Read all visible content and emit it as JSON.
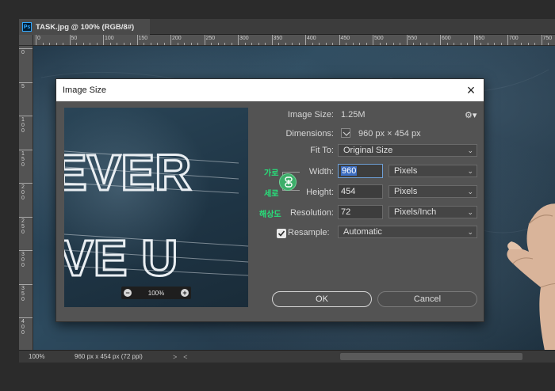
{
  "document": {
    "tab_label": "TASK.jpg @ 100% (RGB/8#)",
    "app_icon": "Ps"
  },
  "rulers": {
    "horizontal": [
      "0",
      "50",
      "100",
      "150",
      "200",
      "250",
      "300",
      "350",
      "400",
      "450",
      "500",
      "550",
      "600",
      "650",
      "700",
      "750"
    ],
    "vertical": [
      "0",
      "5",
      "1 0 0",
      "1 5 0",
      "2 0 0",
      "2 5 0",
      "3 0 0",
      "3 5 0",
      "4 0 0"
    ]
  },
  "status_bar": {
    "zoom": "100%",
    "info": "960 px x 454 px (72 ppi)",
    "arrow": ">",
    "arrow_left": "<"
  },
  "dialog": {
    "title": "Image Size",
    "close_icon": "×",
    "image_size_label": "Image Size:",
    "image_size_value": "1.25M",
    "gear_icon": "⚙▾",
    "dimensions_label": "Dimensions:",
    "dimensions_value": "960 px  ×  454 px",
    "fit_to_label": "Fit To:",
    "fit_to_value": "Original Size",
    "width_label": "Width:",
    "width_value": "960",
    "width_unit": "Pixels",
    "height_label": "Height:",
    "height_value": "454",
    "height_unit": "Pixels",
    "resolution_label": "Resolution:",
    "resolution_value": "72",
    "resolution_unit": "Pixels/Inch",
    "resample_label": "Resample:",
    "resample_value": "Automatic",
    "ok_label": "OK",
    "cancel_label": "Cancel",
    "preview_zoom": "100%",
    "preview_text_line1": "EVER",
    "preview_text_line2": "VE U",
    "annotations": {
      "width_korean": "가로",
      "height_korean": "세로",
      "resolution_korean": "해상도"
    }
  },
  "colors": {
    "accent_green": "#28e07a",
    "link_green": "#3dae6a",
    "selection_blue": "#3d6ec2"
  }
}
